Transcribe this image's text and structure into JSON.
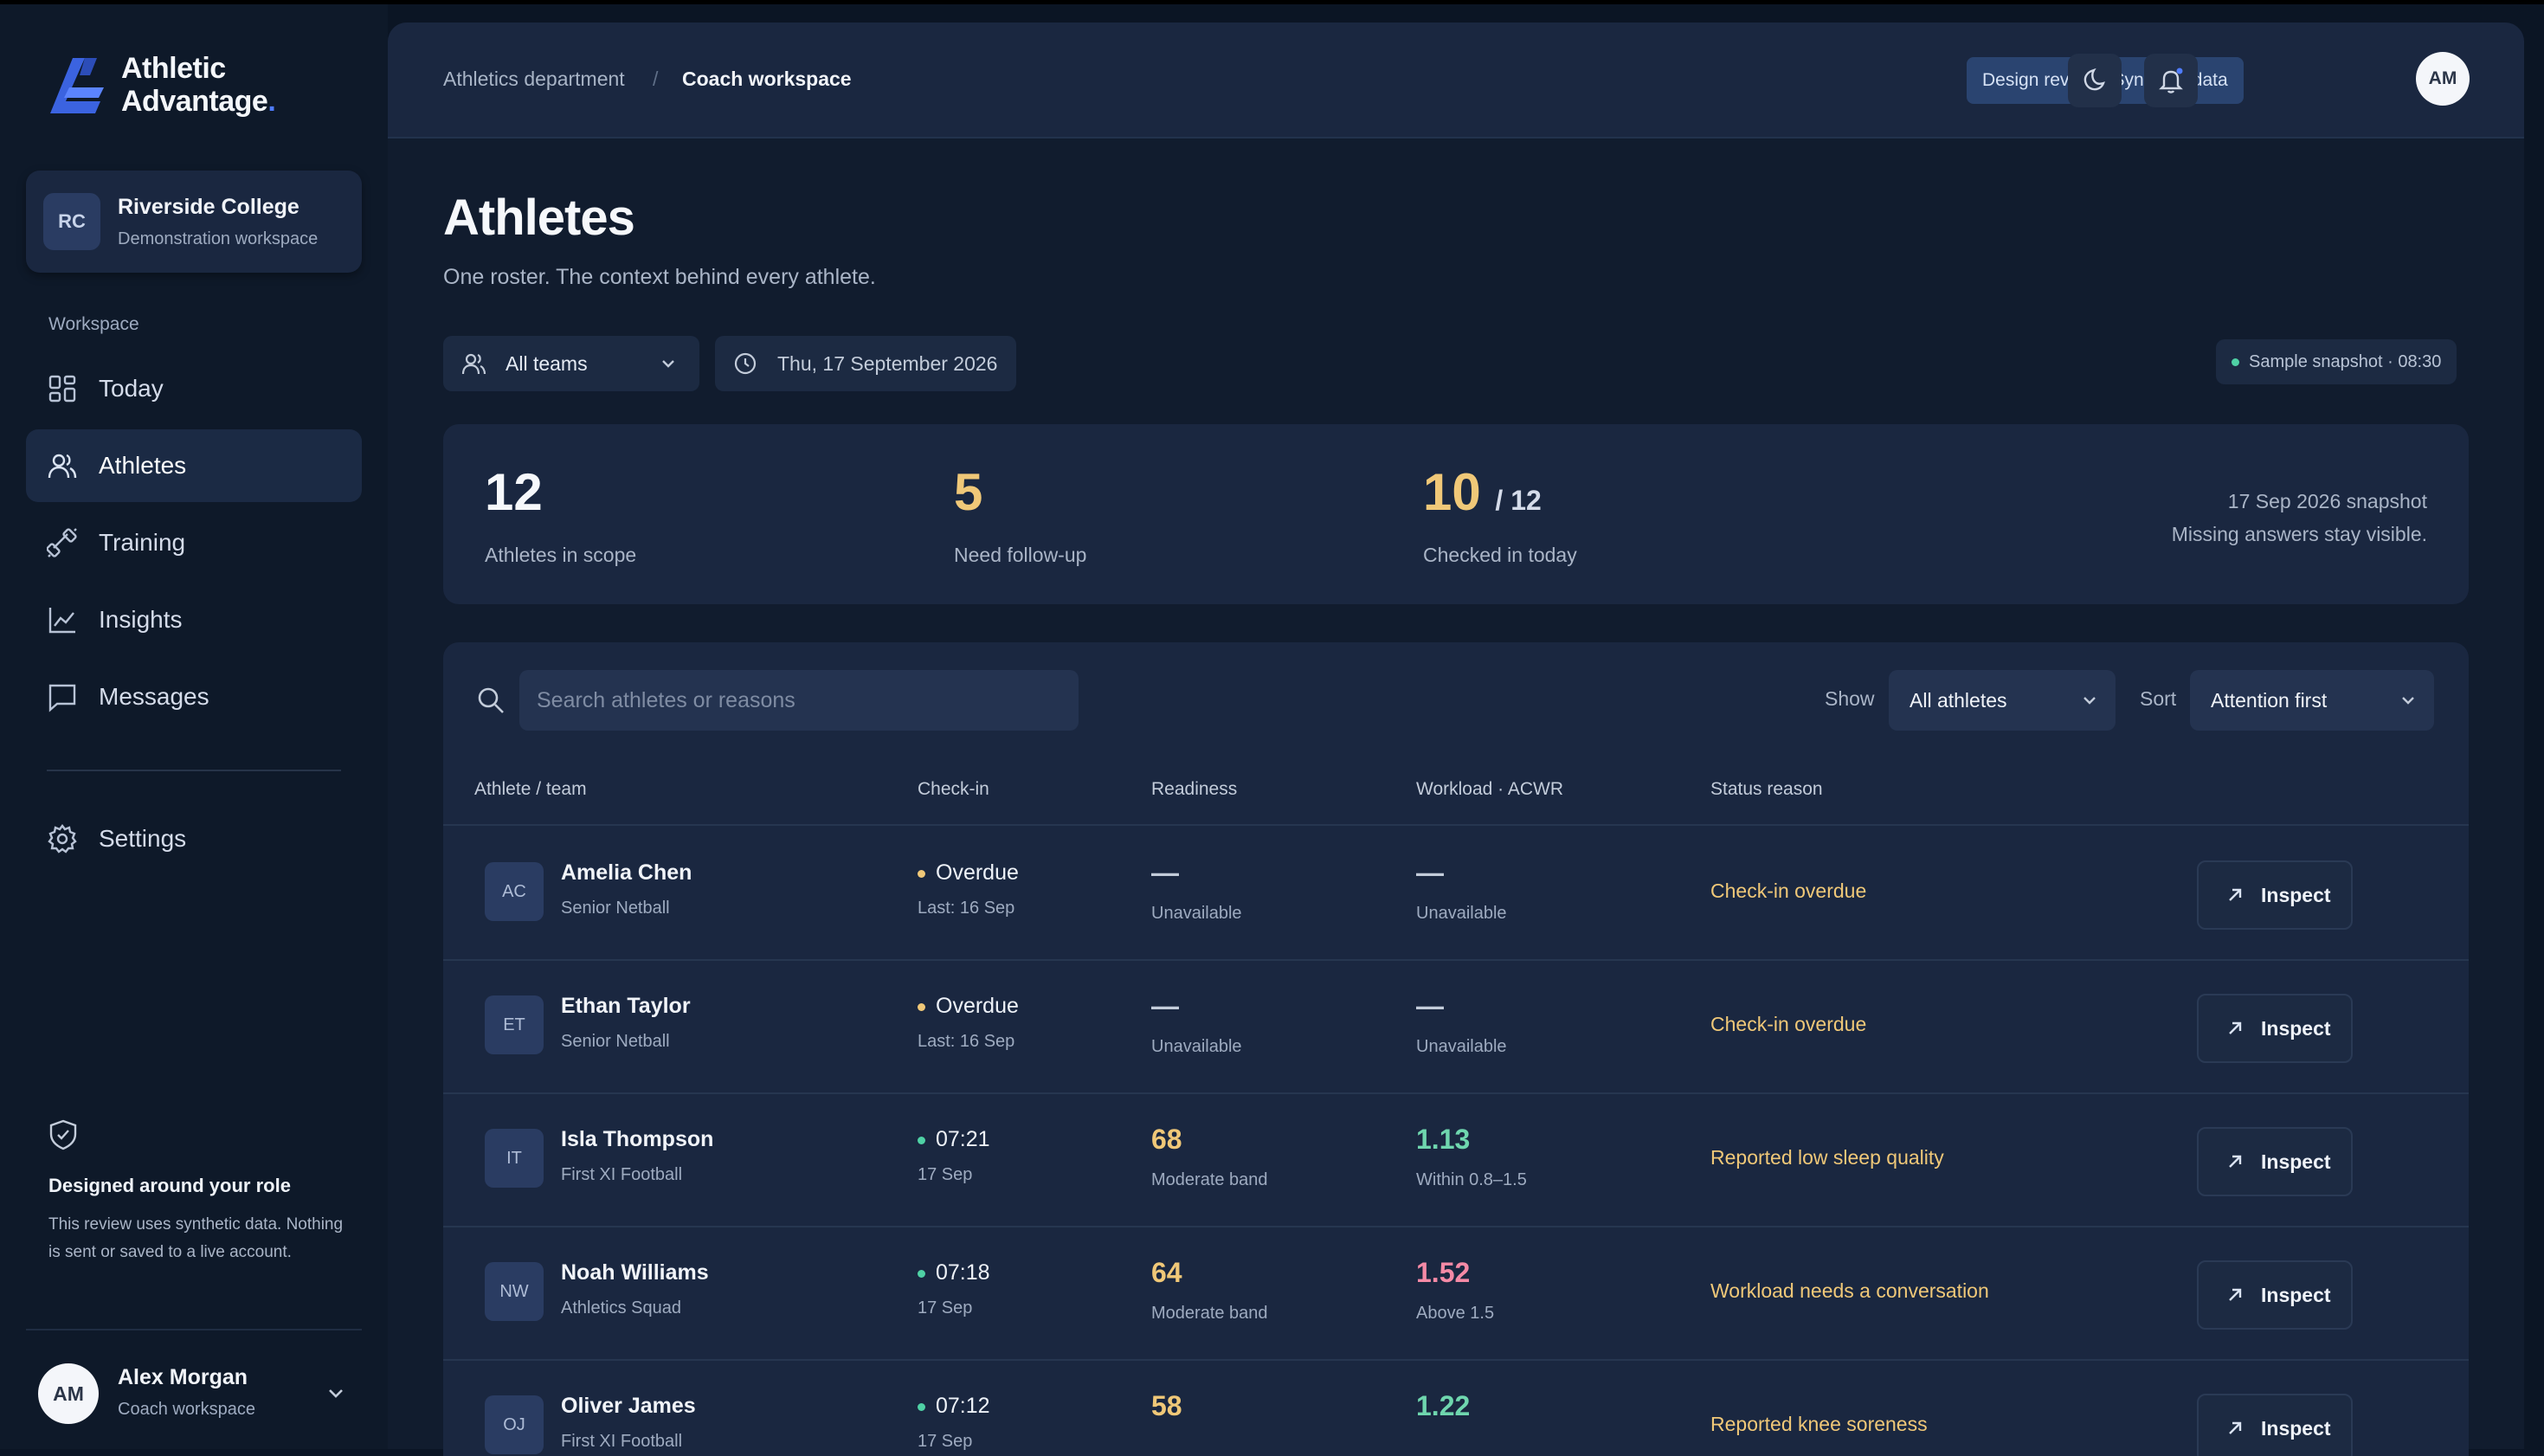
{
  "brand": {
    "name_line1": "Athletic",
    "name_line2": "Advantage",
    "name_dot": "."
  },
  "org": {
    "initials": "RC",
    "name": "Riverside College",
    "subtitle": "Demonstration workspace"
  },
  "sidebar": {
    "section_label": "Workspace",
    "items": [
      {
        "label": "Today",
        "icon": "grid-icon",
        "active": false
      },
      {
        "label": "Athletes",
        "icon": "users-icon",
        "active": true
      },
      {
        "label": "Training",
        "icon": "dumbbell-icon",
        "active": false
      },
      {
        "label": "Insights",
        "icon": "line-chart-icon",
        "active": false
      },
      {
        "label": "Messages",
        "icon": "message-icon",
        "active": false
      }
    ],
    "settings_label": "Settings",
    "role_title": "Designed around your role",
    "role_body": "This review uses synthetic data. Nothing is sent or saved to a live account.",
    "user": {
      "initials": "AM",
      "name": "Alex Morgan",
      "role": "Coach workspace"
    }
  },
  "topbar": {
    "breadcrumb": [
      "Athletics department",
      "Coach workspace"
    ],
    "breadcrumb_sep": "/",
    "badge": "Design review · Synthetic data",
    "avatar_initials": "AM"
  },
  "page": {
    "title": "Athletes",
    "subtitle": "One roster. The context behind every athlete.",
    "team_filter": "All teams",
    "date_filter": "Thu, 17 September 2026",
    "snapshot_badge": "Sample snapshot · 08:30"
  },
  "stats": {
    "in_scope": {
      "value": "12",
      "label": "Athletes in scope"
    },
    "follow_up": {
      "value": "5",
      "label": "Need follow-up"
    },
    "checked_in": {
      "value": "10",
      "of": "/ 12",
      "label": "Checked in today"
    },
    "note_line1": "17 Sep 2026 snapshot",
    "note_line2": "Missing answers stay visible."
  },
  "table": {
    "search_placeholder": "Search athletes or reasons",
    "show_label": "Show",
    "show_value": "All athletes",
    "sort_label": "Sort",
    "sort_value": "Attention first",
    "columns": [
      "Athlete / team",
      "Check-in",
      "Readiness",
      "Workload · ACWR",
      "Status reason"
    ],
    "inspect_label": "Inspect",
    "rows": [
      {
        "initials": "AC",
        "name": "Amelia Chen",
        "team": "Senior Netball",
        "checkin": "Overdue",
        "checkin_sub": "Last: 16 Sep",
        "checkin_color": "#f0c878",
        "readiness": "—",
        "readiness_sub": "Unavailable",
        "readiness_color": "#c3ccda",
        "acwr": "—",
        "acwr_sub": "Unavailable",
        "acwr_color": "#c3ccda",
        "reason": "Check-in overdue",
        "reason_color": "#f0c878"
      },
      {
        "initials": "ET",
        "name": "Ethan Taylor",
        "team": "Senior Netball",
        "checkin": "Overdue",
        "checkin_sub": "Last: 16 Sep",
        "checkin_color": "#f0c878",
        "readiness": "—",
        "readiness_sub": "Unavailable",
        "readiness_color": "#c3ccda",
        "acwr": "—",
        "acwr_sub": "Unavailable",
        "acwr_color": "#c3ccda",
        "reason": "Check-in overdue",
        "reason_color": "#f0c878"
      },
      {
        "initials": "IT",
        "name": "Isla Thompson",
        "team": "First XI Football",
        "checkin": "07:21",
        "checkin_sub": "17 Sep",
        "checkin_color": "#4fd1a5",
        "readiness": "68",
        "readiness_sub": "Moderate band",
        "readiness_color": "#f0c878",
        "acwr": "1.13",
        "acwr_sub": "Within 0.8–1.5",
        "acwr_color": "#6fd6ae",
        "reason": "Reported low sleep quality",
        "reason_color": "#f0c878"
      },
      {
        "initials": "NW",
        "name": "Noah Williams",
        "team": "Athletics Squad",
        "checkin": "07:18",
        "checkin_sub": "17 Sep",
        "checkin_color": "#4fd1a5",
        "readiness": "64",
        "readiness_sub": "Moderate band",
        "readiness_color": "#f0c878",
        "acwr": "1.52",
        "acwr_sub": "Above 1.5",
        "acwr_color": "#f58aa6",
        "reason": "Workload needs a conversation",
        "reason_color": "#f0c878"
      },
      {
        "initials": "OJ",
        "name": "Oliver James",
        "team": "First XI Football",
        "checkin": "07:12",
        "checkin_sub": "17 Sep",
        "checkin_color": "#4fd1a5",
        "readiness": "58",
        "readiness_sub": "",
        "readiness_color": "#f0c878",
        "acwr": "1.22",
        "acwr_sub": "",
        "acwr_color": "#6fd6ae",
        "reason": "Reported knee soreness",
        "reason_color": "#f0c878"
      }
    ]
  },
  "colors": {
    "accent": "#4f7cff",
    "warning": "#f0c878",
    "ok": "#4fd1a5",
    "danger": "#f58aa6"
  }
}
